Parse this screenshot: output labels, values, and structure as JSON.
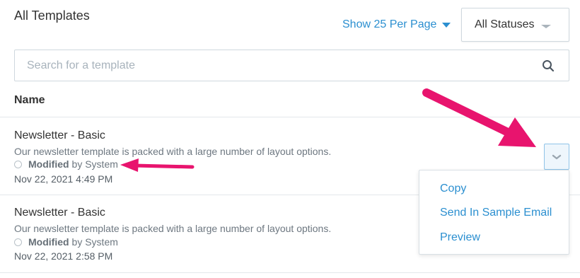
{
  "header": {
    "title": "All Templates",
    "per_page_label": "Show 25 Per Page",
    "status_filter": "All Statuses"
  },
  "search": {
    "placeholder": "Search for a template"
  },
  "table": {
    "column_name": "Name",
    "rows": [
      {
        "title": "Newsletter - Basic",
        "description": "Our newsletter template is packed with a large number of layout options.",
        "modified_label": "Modified",
        "modified_by": "by System",
        "date": "Nov 22, 2021 4:49 PM"
      },
      {
        "title": "Newsletter - Basic",
        "description": "Our newsletter template is packed with a large number of layout options.",
        "modified_label": "Modified",
        "modified_by": "by System",
        "date": "Nov 22, 2021 2:58 PM"
      }
    ]
  },
  "actions_menu": {
    "items": [
      "Copy",
      "Send In Sample Email",
      "Preview"
    ]
  },
  "colors": {
    "accent": "#2b8fd0",
    "annotation": "#e8146e",
    "border": "#cfd8de"
  }
}
